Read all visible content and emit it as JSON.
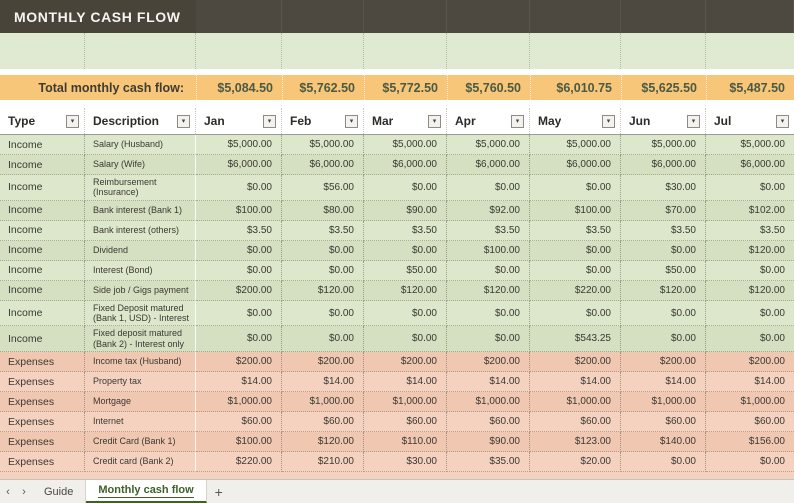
{
  "title": "MONTHLY CASH FLOW",
  "total_row": {
    "label": "Total monthly cash flow:",
    "values": [
      "$5,084.50",
      "$5,762.50",
      "$5,772.50",
      "$5,760.50",
      "$6,010.75",
      "$5,625.50",
      "$5,487.50"
    ]
  },
  "columns": [
    "Type",
    "Description",
    "Jan",
    "Feb",
    "Mar",
    "Apr",
    "May",
    "Jun",
    "Jul"
  ],
  "rows": [
    {
      "type": "Income",
      "description": "Salary (Husband)",
      "values": [
        "$5,000.00",
        "$5,000.00",
        "$5,000.00",
        "$5,000.00",
        "$5,000.00",
        "$5,000.00",
        "$5,000.00"
      ]
    },
    {
      "type": "Income",
      "description": "Salary (Wife)",
      "values": [
        "$6,000.00",
        "$6,000.00",
        "$6,000.00",
        "$6,000.00",
        "$6,000.00",
        "$6,000.00",
        "$6,000.00"
      ]
    },
    {
      "type": "Income",
      "description": "Reimbursement (Insurance)",
      "values": [
        "$0.00",
        "$56.00",
        "$0.00",
        "$0.00",
        "$0.00",
        "$30.00",
        "$0.00"
      ]
    },
    {
      "type": "Income",
      "description": "Bank interest (Bank 1)",
      "values": [
        "$100.00",
        "$80.00",
        "$90.00",
        "$92.00",
        "$100.00",
        "$70.00",
        "$102.00"
      ]
    },
    {
      "type": "Income",
      "description": "Bank interest (others)",
      "values": [
        "$3.50",
        "$3.50",
        "$3.50",
        "$3.50",
        "$3.50",
        "$3.50",
        "$3.50"
      ]
    },
    {
      "type": "Income",
      "description": "Dividend",
      "values": [
        "$0.00",
        "$0.00",
        "$0.00",
        "$100.00",
        "$0.00",
        "$0.00",
        "$120.00"
      ]
    },
    {
      "type": "Income",
      "description": "Interest (Bond)",
      "values": [
        "$0.00",
        "$0.00",
        "$50.00",
        "$0.00",
        "$0.00",
        "$50.00",
        "$0.00"
      ]
    },
    {
      "type": "Income",
      "description": "Side job / Gigs payment",
      "values": [
        "$200.00",
        "$120.00",
        "$120.00",
        "$120.00",
        "$220.00",
        "$120.00",
        "$120.00"
      ]
    },
    {
      "type": "Income",
      "description": "Fixed Deposit matured (Bank 1, USD) - Interest",
      "values": [
        "$0.00",
        "$0.00",
        "$0.00",
        "$0.00",
        "$0.00",
        "$0.00",
        "$0.00"
      ]
    },
    {
      "type": "Income",
      "description": "Fixed deposit matured (Bank 2) - Interest only",
      "values": [
        "$0.00",
        "$0.00",
        "$0.00",
        "$0.00",
        "$543.25",
        "$0.00",
        "$0.00"
      ]
    },
    {
      "type": "Expenses",
      "description": "Income tax (Husband)",
      "values": [
        "$200.00",
        "$200.00",
        "$200.00",
        "$200.00",
        "$200.00",
        "$200.00",
        "$200.00"
      ]
    },
    {
      "type": "Expenses",
      "description": "Property tax",
      "values": [
        "$14.00",
        "$14.00",
        "$14.00",
        "$14.00",
        "$14.00",
        "$14.00",
        "$14.00"
      ]
    },
    {
      "type": "Expenses",
      "description": "Mortgage",
      "values": [
        "$1,000.00",
        "$1,000.00",
        "$1,000.00",
        "$1,000.00",
        "$1,000.00",
        "$1,000.00",
        "$1,000.00"
      ]
    },
    {
      "type": "Expenses",
      "description": "Internet",
      "values": [
        "$60.00",
        "$60.00",
        "$60.00",
        "$60.00",
        "$60.00",
        "$60.00",
        "$60.00"
      ]
    },
    {
      "type": "Expenses",
      "description": "Credit Card (Bank 1)",
      "values": [
        "$100.00",
        "$120.00",
        "$110.00",
        "$90.00",
        "$123.00",
        "$140.00",
        "$156.00"
      ]
    },
    {
      "type": "Expenses",
      "description": "Credit card (Bank 2)",
      "values": [
        "$220.00",
        "$210.00",
        "$30.00",
        "$35.00",
        "$20.00",
        "$0.00",
        "$0.00"
      ]
    }
  ],
  "sheet_tabs": {
    "nav_left": "‹",
    "nav_right": "›",
    "items": [
      {
        "label": "Guide",
        "active": false
      },
      {
        "label": "Monthly cash flow",
        "active": true
      }
    ],
    "add_label": "+"
  },
  "icons": {
    "filter": "▾"
  },
  "colors": {
    "title_bar_bg": "#48443a",
    "title_bar_bg_right": "#4d4940",
    "title_text": "#f7f5f0",
    "band_bg": "#e0e9d2",
    "total_bg": "#f8c678",
    "total_label_text": "#3f3c35",
    "total_value_text": "#4a5a44",
    "header_text": "#2e2c28",
    "income_row": "#dce7cb",
    "income_row_alt": "#d4e0c1",
    "expense_row": "#f0c7b1",
    "expense_row_alt": "#f5d2c0",
    "cell_text": "#3b3933",
    "tab_bar_bg": "#f1efeb",
    "tab_active_text": "#3f6028"
  }
}
